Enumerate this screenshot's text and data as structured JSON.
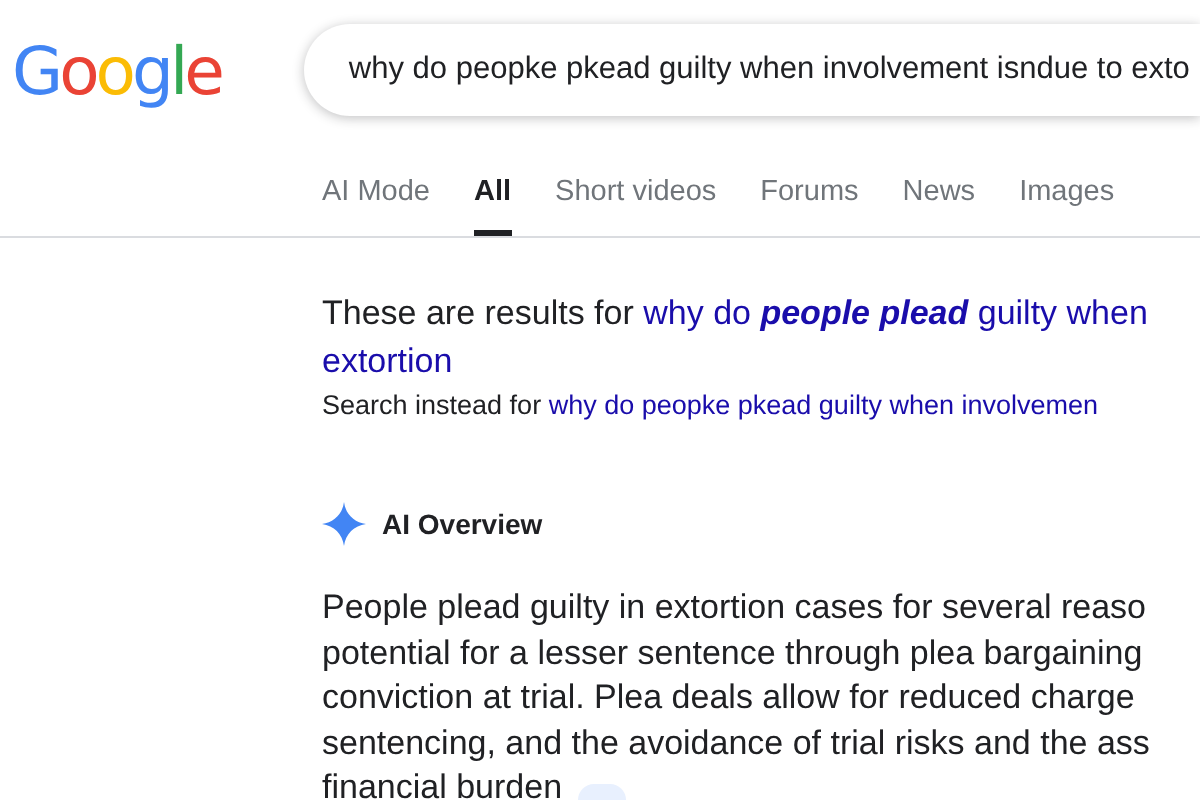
{
  "logo": {
    "letters": [
      {
        "char": "G",
        "color": "#4285f4"
      },
      {
        "char": "o",
        "color": "#ea4335"
      },
      {
        "char": "o",
        "color": "#fbbc05"
      },
      {
        "char": "g",
        "color": "#4285f4"
      },
      {
        "char": "l",
        "color": "#34a853"
      },
      {
        "char": "e",
        "color": "#ea4335"
      }
    ]
  },
  "search": {
    "value": "why do peopke pkead guilty when involvement isndue to exto"
  },
  "tabs": [
    {
      "label": "AI Mode",
      "selected": false
    },
    {
      "label": "All",
      "selected": true
    },
    {
      "label": "Short videos",
      "selected": false
    },
    {
      "label": "Forums",
      "selected": false
    },
    {
      "label": "News",
      "selected": false
    },
    {
      "label": "Images",
      "selected": false
    }
  ],
  "correction": {
    "prefix": "These are results for ",
    "link": "why do **people plead** guilty when",
    "link_continued": "extortion",
    "instead_prefix": "Search instead for ",
    "instead_link": "why do peopke pkead guilty when involvemen"
  },
  "ai_overview": {
    "title": "AI Overview",
    "lines": [
      "People plead guilty in extortion cases for several reaso",
      "potential for a lesser sentence through plea bargaining",
      "conviction at trial. Plea deals allow for reduced charge",
      "sentencing, and the avoidance of trial risks and the ass",
      "financial burden"
    ]
  }
}
